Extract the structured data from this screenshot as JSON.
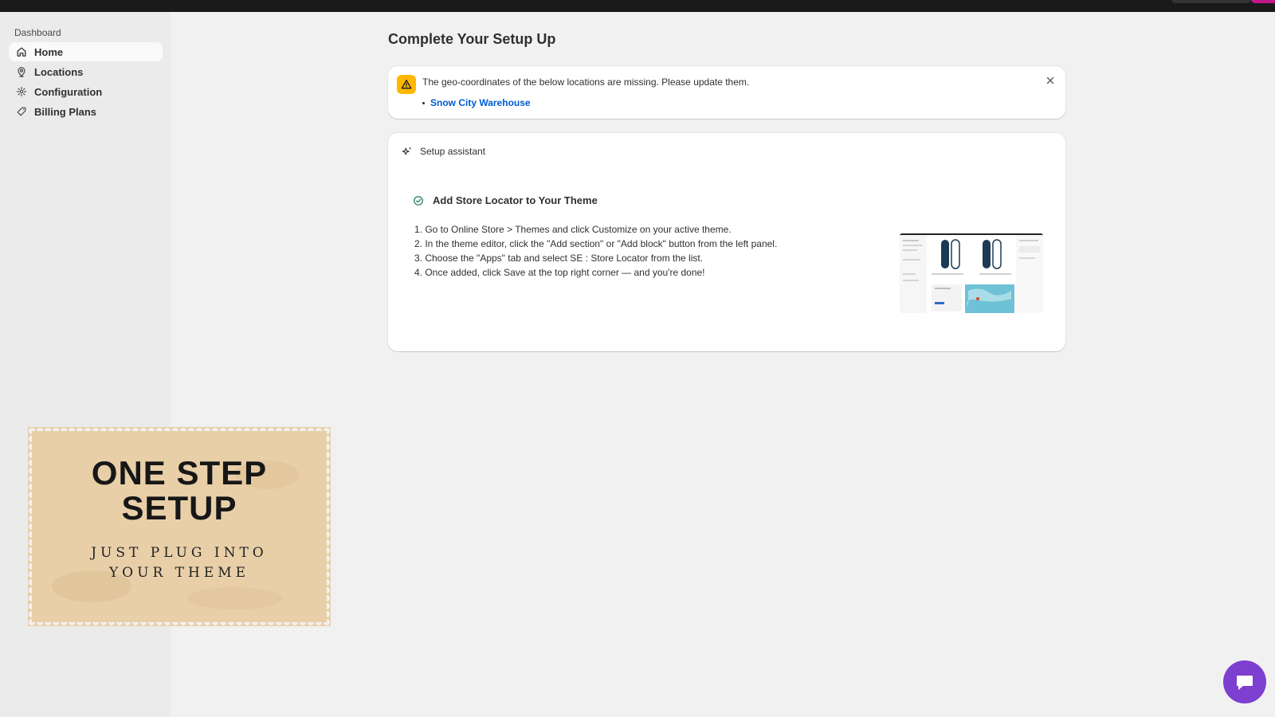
{
  "sidebar": {
    "section_label": "Dashboard",
    "items": [
      {
        "label": "Home",
        "icon": "home-icon",
        "active": true
      },
      {
        "label": "Locations",
        "icon": "map-pin-icon",
        "active": false
      },
      {
        "label": "Configuration",
        "icon": "gear-icon",
        "active": false
      },
      {
        "label": "Billing Plans",
        "icon": "tag-icon",
        "active": false
      }
    ]
  },
  "main": {
    "title": "Complete Your Setup Up",
    "banner": {
      "message": "The geo-coordinates of the below locations are missing. Please update them.",
      "locations": [
        "Snow City Warehouse"
      ]
    },
    "setup": {
      "header": "Setup assistant",
      "step_title": "Add Store Locator to Your Theme",
      "instructions": [
        "1. Go to Online Store > Themes and click Customize on your active theme.",
        "2. In the theme editor, click the \"Add section\" or \"Add block\" button from the left panel.",
        "3. Choose the \"Apps\" tab and select SE : Store Locator from the list.",
        "4. Once added, click Save at the top right corner — and you're done!"
      ]
    }
  },
  "promo": {
    "headline_line1": "ONE STEP",
    "headline_line2": "SETUP",
    "tagline": "JUST PLUG INTO YOUR THEME"
  },
  "colors": {
    "accent_link": "#005bd3",
    "warning": "#ffb800",
    "success": "#29845a",
    "chat": "#7c3fcf",
    "promo_bg": "#e8cfa8"
  }
}
